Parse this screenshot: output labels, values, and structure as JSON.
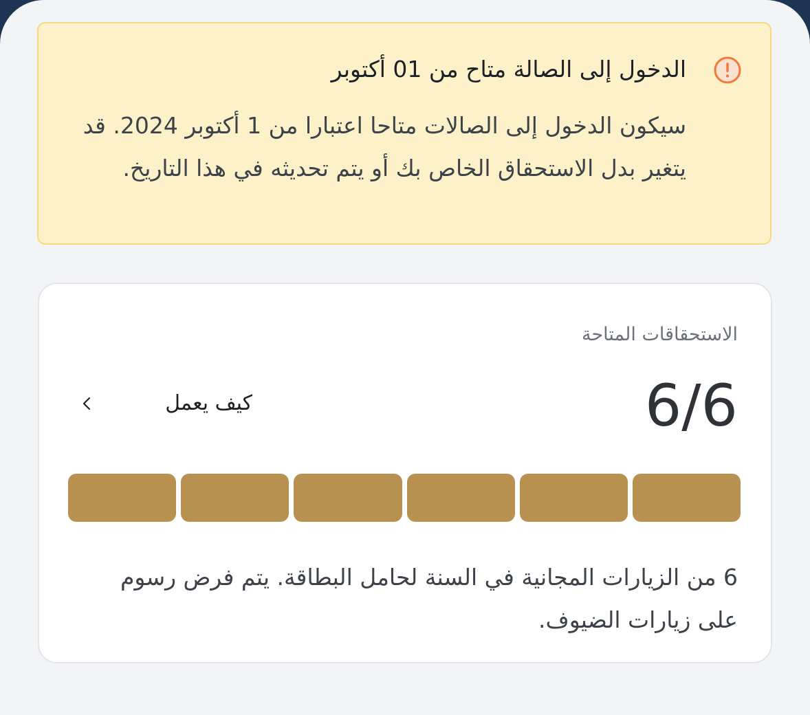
{
  "notice": {
    "title": "الدخول إلى الصالة متاح من 01 أكتوبر",
    "body": "سيكون الدخول إلى الصالات متاحا اعتبارا من 1 أكتوبر 2024. قد يتغير بدل الاستحقاق الخاص بك أو يتم تحديثه في هذا التاريخ.",
    "icon": "exclamation-circle-icon",
    "accent_color": "#f07a3a",
    "background_color": "#fcf1c9"
  },
  "entitlements": {
    "label": "الاستحقاقات المتاحة",
    "count_text": "6/6",
    "available": 6,
    "total": 6,
    "how_it_works_label": "كيف يعمل",
    "how_it_works_icon": "chevron-left-icon",
    "description": "6 من الزيارات المجانية في السنة لحامل البطاقة. يتم فرض رسوم على زيارات الضيوف.",
    "filled_color": "#b8904f",
    "empty_color": "#e6e1d6"
  }
}
